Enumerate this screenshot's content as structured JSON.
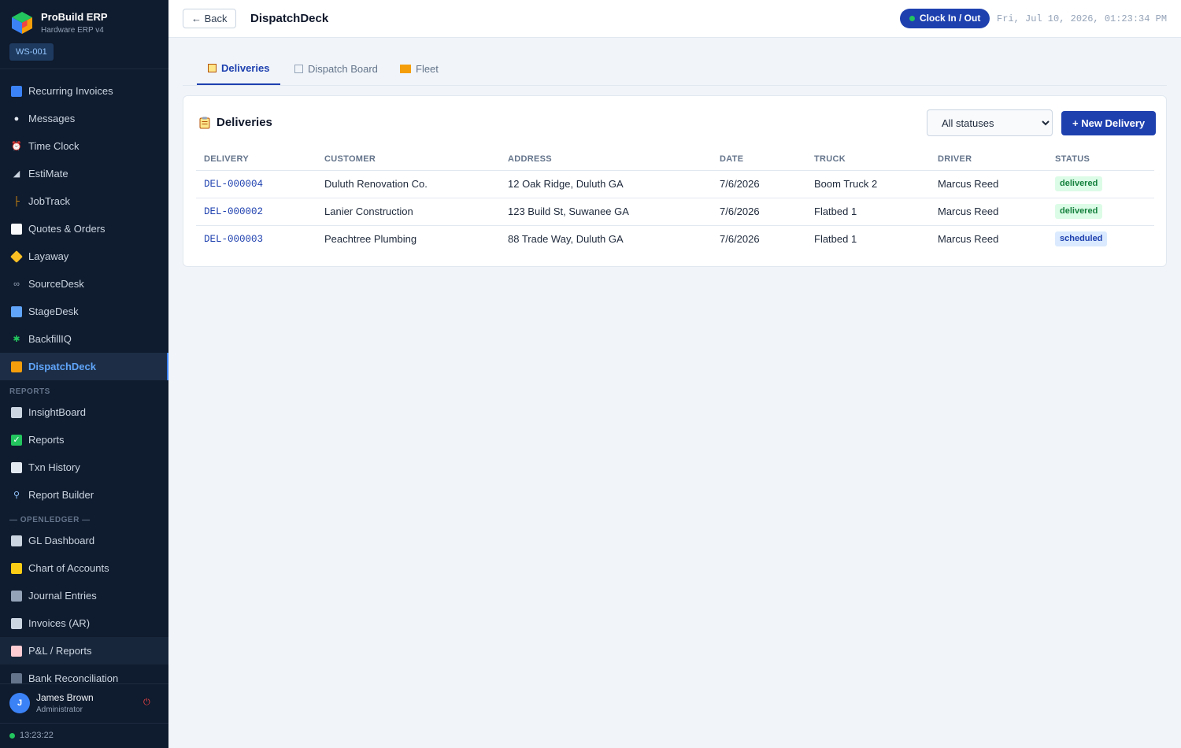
{
  "brand": {
    "name": "ProBuild ERP",
    "subtitle": "Hardware ERP v4",
    "workstation": "WS-001"
  },
  "sidebar": {
    "items": [
      {
        "label": "Recurring Invoices",
        "icon": "recurring-icon",
        "color": "#3b82f6"
      },
      {
        "label": "Messages",
        "icon": "speech-bubble-icon",
        "color": "#e2e8f0"
      },
      {
        "label": "Time Clock",
        "icon": "alarm-clock-icon",
        "color": "#ef4444"
      },
      {
        "label": "EstiMate",
        "icon": "triangle-ruler-icon",
        "color": "#cbd5e1"
      },
      {
        "label": "JobTrack",
        "icon": "crane-icon",
        "color": "#f59e0b"
      },
      {
        "label": "Quotes & Orders",
        "icon": "memo-icon",
        "color": "#f8fafc"
      },
      {
        "label": "Layaway",
        "icon": "tag-icon",
        "color": "#fbbf24"
      },
      {
        "label": "SourceDesk",
        "icon": "link-icon",
        "color": "#94a3b8"
      },
      {
        "label": "StageDesk",
        "icon": "inbox-tray-icon",
        "color": "#60a5fa"
      },
      {
        "label": "BackfillIQ",
        "icon": "puzzle-icon",
        "color": "#22c55e"
      },
      {
        "label": "DispatchDeck",
        "icon": "truck-icon",
        "color": "#f59e0b"
      }
    ],
    "reports_heading": "REPORTS",
    "report_items": [
      {
        "label": "InsightBoard",
        "icon": "bar-chart-icon"
      },
      {
        "label": "Reports",
        "icon": "check-box-icon"
      },
      {
        "label": "Txn History",
        "icon": "page-icon"
      },
      {
        "label": "Report Builder",
        "icon": "magnifier-icon"
      }
    ],
    "ledger_heading": "— OPENLEDGER —",
    "ledger_items": [
      {
        "label": "GL Dashboard",
        "icon": "bar-chart-icon"
      },
      {
        "label": "Chart of Accounts",
        "icon": "ledger-icon"
      },
      {
        "label": "Journal Entries",
        "icon": "notebook-icon"
      },
      {
        "label": "Invoices (AR)",
        "icon": "receipt-icon"
      },
      {
        "label": "P&L / Reports",
        "icon": "chart-down-icon"
      },
      {
        "label": "Bank Reconciliation",
        "icon": "bank-icon"
      }
    ]
  },
  "user": {
    "initial": "J",
    "name": "James Brown",
    "role": "Administrator"
  },
  "clock": {
    "time": "13:23:22"
  },
  "topbar": {
    "back_label": "← Back",
    "title": "DispatchDeck",
    "clock_button": "Clock In / Out",
    "datetime": "Fri, Jul 10, 2026, 01:23:34 PM"
  },
  "tabs": [
    {
      "label": "Deliveries",
      "icon": "clipboard-icon"
    },
    {
      "label": "Dispatch Board",
      "icon": "board-icon"
    },
    {
      "label": "Fleet",
      "icon": "truck-icon"
    }
  ],
  "card": {
    "title": "Deliveries",
    "filter_selected": "All statuses",
    "new_button": "+ New Delivery"
  },
  "table": {
    "columns": [
      "DELIVERY",
      "CUSTOMER",
      "ADDRESS",
      "DATE",
      "TRUCK",
      "DRIVER",
      "STATUS"
    ],
    "rows": [
      {
        "id": "DEL-000004",
        "customer": "Duluth Renovation Co.",
        "address": "12 Oak Ridge, Duluth GA",
        "date": "7/6/2026",
        "truck": "Boom Truck 2",
        "driver": "Marcus Reed",
        "status": "delivered"
      },
      {
        "id": "DEL-000002",
        "customer": "Lanier Construction",
        "address": "123 Build St, Suwanee GA",
        "date": "7/6/2026",
        "truck": "Flatbed 1",
        "driver": "Marcus Reed",
        "status": "delivered"
      },
      {
        "id": "DEL-000003",
        "customer": "Peachtree Plumbing",
        "address": "88 Trade Way, Duluth GA",
        "date": "7/6/2026",
        "truck": "Flatbed 1",
        "driver": "Marcus Reed",
        "status": "scheduled"
      }
    ]
  },
  "colors": {
    "accent": "#1e40af",
    "sidebar_bg": "#0f1b2e",
    "active_nav": "#60a5fa",
    "delivered": "#15803d",
    "scheduled": "#1e40af"
  }
}
